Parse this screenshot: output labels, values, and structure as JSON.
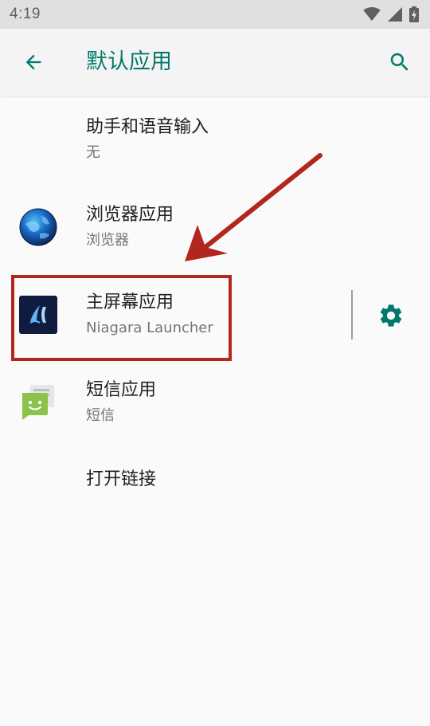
{
  "status_bar": {
    "time": "4:19"
  },
  "app_bar": {
    "title": "默认应用",
    "back_icon": "arrow-back-icon",
    "search_icon": "search-icon"
  },
  "items": [
    {
      "title": "助手和语音输入",
      "subtitle": "无"
    },
    {
      "title": "浏览器应用",
      "subtitle": "浏览器",
      "icon": "globe-icon"
    },
    {
      "title": "主屏幕应用",
      "subtitle": "Niagara Launcher",
      "icon": "niagara-launcher-icon",
      "action_icon": "gear-icon"
    },
    {
      "title": "短信应用",
      "subtitle": "短信",
      "icon": "messaging-icon"
    },
    {
      "title": "打开链接"
    }
  ],
  "colors": {
    "accent": "#00796b",
    "annotation": "#b3261e",
    "status_bar_bg": "#e0e0e0",
    "background": "#fafafa"
  }
}
